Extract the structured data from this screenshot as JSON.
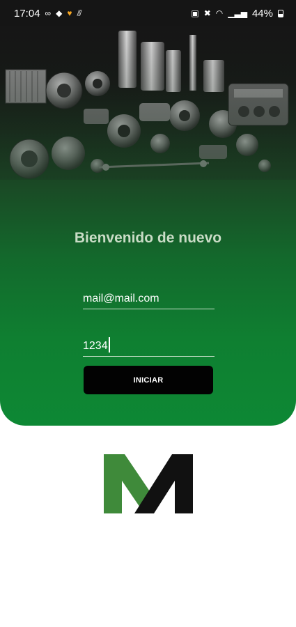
{
  "status_bar": {
    "time": "17:04",
    "battery": "44%",
    "left_icons": [
      "voicemail-icon",
      "water-drop-icon",
      "heart-icon",
      "signal-off-icon"
    ],
    "right_icons": [
      "sim-icon",
      "mute-icon",
      "wifi-icon",
      "signal-icon",
      "battery-icon"
    ]
  },
  "login": {
    "title": "Bienvenido de nuevo",
    "email_value": "mail@mail.com",
    "password_value": "1234",
    "button_label": "INICIAR"
  },
  "colors": {
    "green_dark": "#13692c",
    "green_bright": "#0d8834",
    "logo_green": "#3f8a3a",
    "logo_black": "#111111",
    "button": "#020202"
  }
}
